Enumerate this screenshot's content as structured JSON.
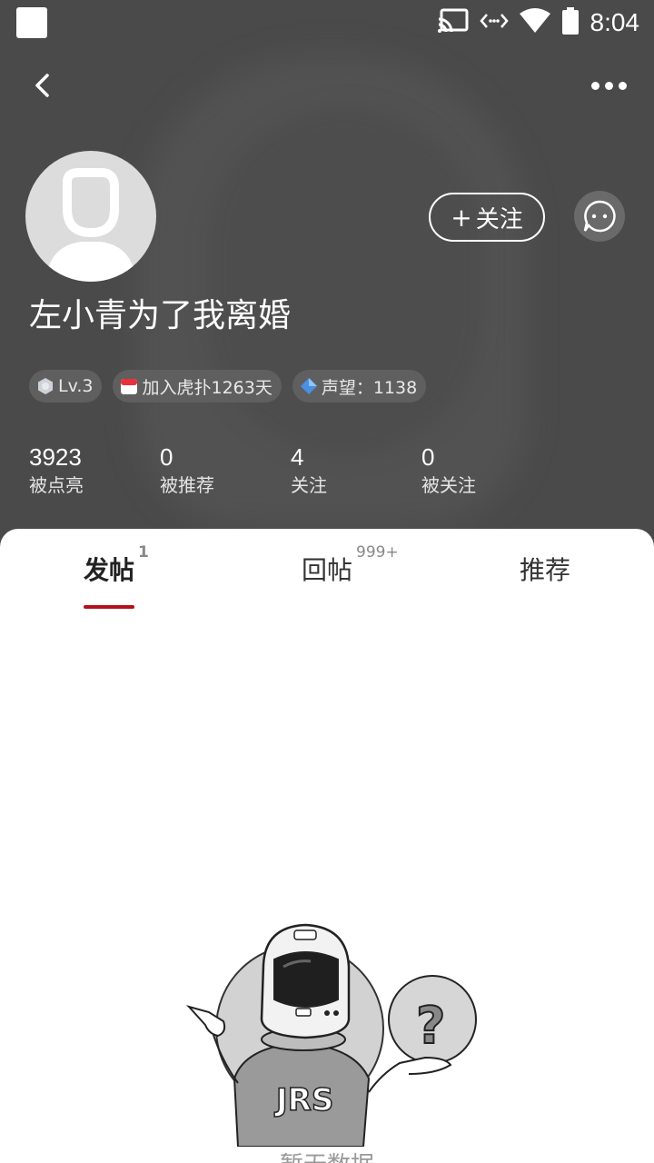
{
  "status_bar": {
    "time": "8:04"
  },
  "profile": {
    "username": "左小青为了我离婚",
    "follow_label": "关注",
    "badges": [
      {
        "icon": "level-shield-icon",
        "text": "Lv.3"
      },
      {
        "icon": "calendar-icon",
        "text": "加入虎扑1263天"
      },
      {
        "icon": "prestige-diamond-icon",
        "text": "声望：1138"
      }
    ],
    "stats": [
      {
        "value": "3923",
        "label": "被点亮"
      },
      {
        "value": "0",
        "label": "被推荐"
      },
      {
        "value": "4",
        "label": "关注"
      },
      {
        "value": "0",
        "label": "被关注"
      }
    ]
  },
  "tabs": [
    {
      "label": "发帖",
      "count": "1",
      "active": true
    },
    {
      "label": "回帖",
      "count": "999+",
      "active": false
    },
    {
      "label": "推荐",
      "count": "",
      "active": false
    }
  ],
  "empty_state": {
    "text": "暂无数据"
  },
  "colors": {
    "header_bg": "#4a4a4b",
    "accent": "#b3111c"
  }
}
